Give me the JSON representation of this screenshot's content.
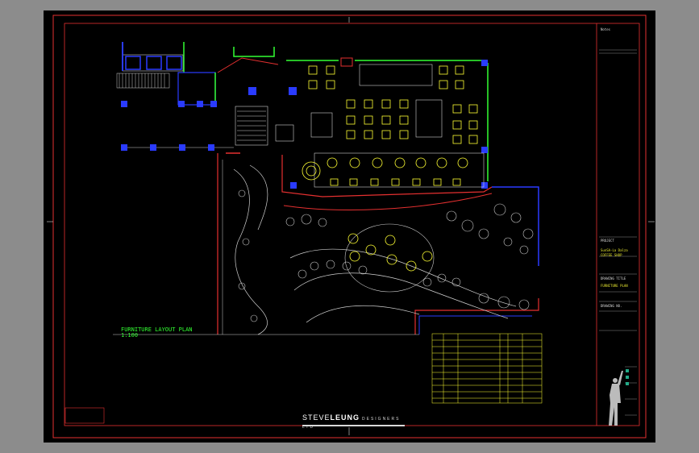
{
  "drawing": {
    "plan_title": "FURNITURE LAYOUT PLAN",
    "plan_scale": "1:100",
    "brand_part1": "STEVE",
    "brand_part2": "LEUNG",
    "brand_part3": "DESIGNERS LTD",
    "stamp_text": "",
    "sheet_info": {
      "notes_label": "Notes",
      "project_label": "PROJECT",
      "project_value": "SunSA-La Dalza COFFEE SHOP",
      "title_label": "DRAWING TITLE",
      "title_value": "FURNITURE PLAN",
      "drawing_no_label": "DRAWING NO."
    },
    "colors": {
      "background": "#000000",
      "frame": "#e53030",
      "wall": "#33ff33",
      "window": "#2a3bff",
      "furniture": "#ffff33",
      "line": "#d0d0d0"
    }
  }
}
